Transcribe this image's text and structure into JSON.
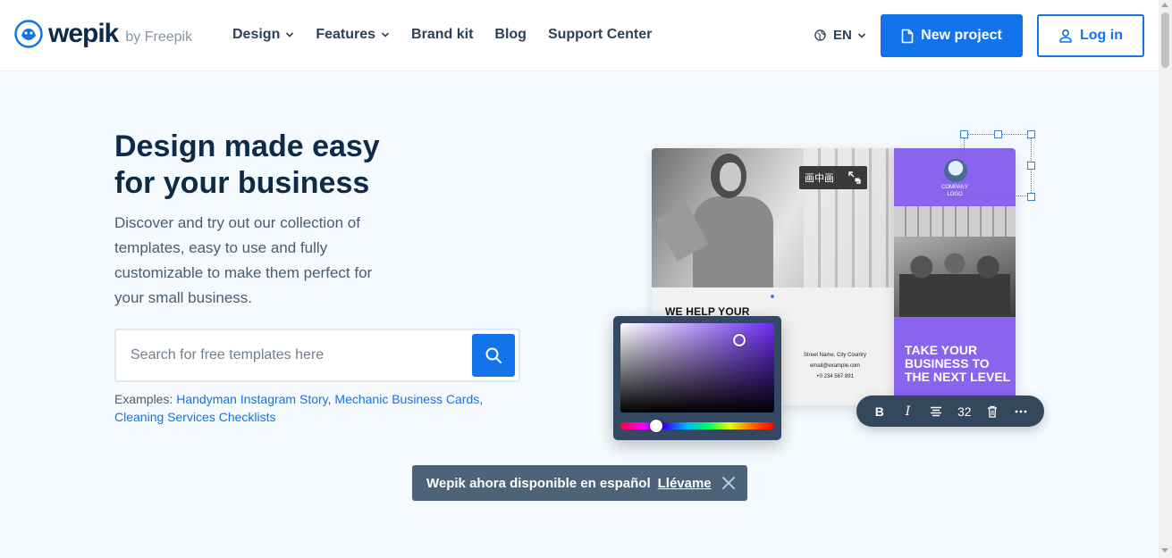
{
  "header": {
    "logo_text": "wepik",
    "logo_by": "by Freepik",
    "nav": [
      {
        "label": "Design",
        "has_dropdown": true
      },
      {
        "label": "Features",
        "has_dropdown": true
      },
      {
        "label": "Brand kit",
        "has_dropdown": false
      },
      {
        "label": "Blog",
        "has_dropdown": false
      },
      {
        "label": "Support Center",
        "has_dropdown": false
      }
    ],
    "language": "EN",
    "new_project_label": "New project",
    "login_label": "Log in"
  },
  "hero": {
    "title_line1": "Design made easy",
    "title_line2": "for your business",
    "description": "Discover and try out our collection of templates, easy to use and fully customizable to make them perfect for your small business.",
    "search_placeholder": "Search for free templates here",
    "examples_label": "Examples:",
    "examples": [
      "Handyman Instagram Story",
      "Mechanic Business Cards",
      "Cleaning Services Checklists"
    ]
  },
  "illustration": {
    "pip_label": "画中画",
    "card_heading": "WE HELP YOUR",
    "contact_lines": [
      "Street Name, City Country",
      "email@example.com",
      "+0 234 567 891"
    ],
    "company_line1": "COMPANY",
    "company_line2": "LOGO",
    "side_cta": "TAKE YOUR BUSINESS TO THE NEXT LEVEL",
    "toolbar_font_size": "32"
  },
  "toast": {
    "message": "Wepik ahora disponible en español",
    "link": "Llévame"
  },
  "colors": {
    "brand_blue": "#1273eb",
    "navy": "#0e2a47",
    "purple": "#8a63ee",
    "toast_bg": "#4c6379"
  }
}
